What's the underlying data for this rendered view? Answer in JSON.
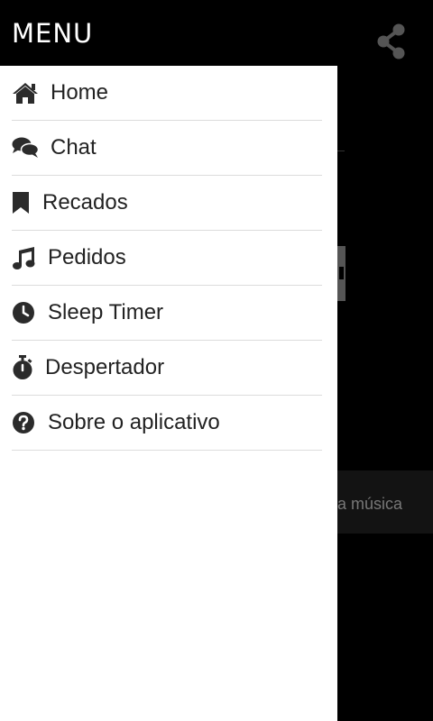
{
  "header": {
    "title": "MENU",
    "share_icon": "share-icon"
  },
  "drawer": {
    "items": [
      {
        "label": "Home",
        "icon": "home-icon"
      },
      {
        "label": "Chat",
        "icon": "chat-icon"
      },
      {
        "label": "Recados",
        "icon": "bookmark-icon"
      },
      {
        "label": "Pedidos",
        "icon": "music-note-icon"
      },
      {
        "label": "Sleep Timer",
        "icon": "clock-icon"
      },
      {
        "label": "Despertador",
        "icon": "stopwatch-icon"
      },
      {
        "label": "Sobre o aplicativo",
        "icon": "question-icon"
      }
    ]
  },
  "background": {
    "partial_text": "a música"
  },
  "colors": {
    "topbar": "#000000",
    "drawer": "#ffffff",
    "icon": "#2b2b2b",
    "divider": "#dcdcdc"
  }
}
